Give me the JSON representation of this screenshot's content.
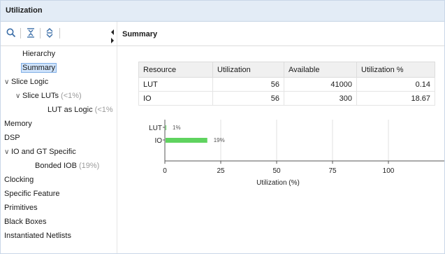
{
  "window": {
    "title": "Utilization"
  },
  "toolbar": {
    "icons": [
      "search-icon",
      "collapse-all-icon",
      "expand-all-icon"
    ]
  },
  "panel": {
    "header": "Summary"
  },
  "tree": {
    "items": [
      {
        "label": "Hierarchy",
        "suffix": ""
      },
      {
        "label": "Summary",
        "suffix": ""
      },
      {
        "label": "Slice Logic",
        "suffix": ""
      },
      {
        "label": "Slice LUTs",
        "suffix": "(<1%)"
      },
      {
        "label": "LUT as Logic",
        "suffix": "(<1%"
      },
      {
        "label": "Memory",
        "suffix": ""
      },
      {
        "label": "DSP",
        "suffix": ""
      },
      {
        "label": "IO and GT Specific",
        "suffix": ""
      },
      {
        "label": "Bonded IOB",
        "suffix": "(19%)"
      },
      {
        "label": "Clocking",
        "suffix": ""
      },
      {
        "label": "Specific Feature",
        "suffix": ""
      },
      {
        "label": "Primitives",
        "suffix": ""
      },
      {
        "label": "Black Boxes",
        "suffix": ""
      },
      {
        "label": "Instantiated Netlists",
        "suffix": ""
      }
    ]
  },
  "table": {
    "columns": [
      "Resource",
      "Utilization",
      "Available",
      "Utilization %"
    ],
    "rows": [
      [
        "LUT",
        "56",
        "41000",
        "0.14"
      ],
      [
        "IO",
        "56",
        "300",
        "18.67"
      ]
    ]
  },
  "chart_data": {
    "type": "bar",
    "orientation": "horizontal",
    "categories": [
      "LUT",
      "IO"
    ],
    "values": [
      0.14,
      18.67
    ],
    "data_labels": [
      "1%",
      "19%"
    ],
    "xlabel": "Utilization (%)",
    "xlim": [
      0,
      125
    ],
    "x_ticks": [
      0,
      25,
      50,
      75,
      100
    ],
    "grid": true,
    "bar_color": "#5fd35f"
  }
}
